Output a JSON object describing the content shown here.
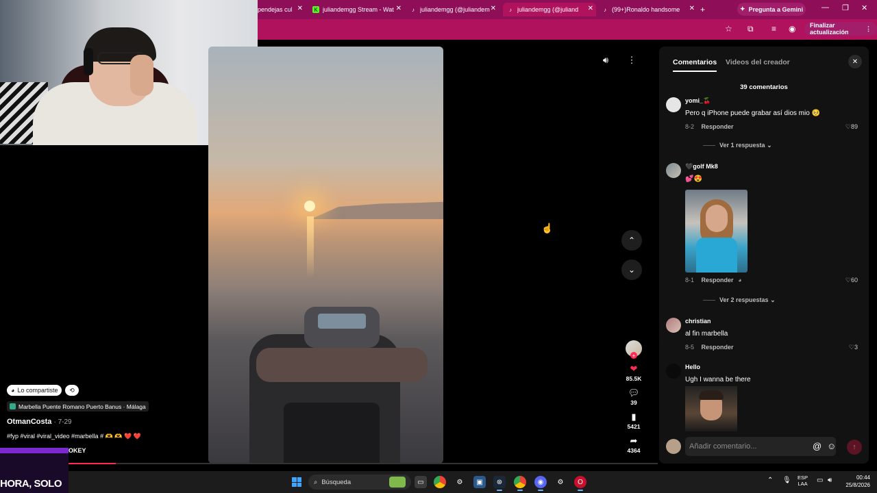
{
  "browser": {
    "tabs": [
      {
        "label": "pendejas cul",
        "active": false
      },
      {
        "label": "juliandemgg Stream - Wat",
        "active": false
      },
      {
        "label": "juliandemgg (@juliandem",
        "active": false
      },
      {
        "label": "juliandemgg (@juliand",
        "active": true
      },
      {
        "label": "(99+)Ronaldo handsome",
        "active": false
      }
    ],
    "new_tab": "+",
    "gemini_label": "Pregunta a Gemini",
    "finalize_update": "Finalizar actualización"
  },
  "video_post": {
    "shared_label": "Lo compartiste",
    "location": "Marbella Puente Romano Puerto Banus · Málaga",
    "author": "OtmanCosta",
    "date": "· 7-29",
    "caption": "#fyp #viral #viral_video #marbella # 🫶 🫶 ❤️ ❤️",
    "music_fragment": "OKEY",
    "progress_fraction": 0.08
  },
  "actions": {
    "likes": "85.5K",
    "comments": "39",
    "saves": "5421",
    "shares": "4364"
  },
  "stream_overlay_text": "HORA, SOLO",
  "comments_panel": {
    "tabs": [
      "Comentarios",
      "Videos del creador"
    ],
    "count_label": "39 comentarios",
    "reply_label": "Responder",
    "items": [
      {
        "user": "yomi_🍒",
        "text": "Pero q iPhone puede grabar así dios mio 🥺",
        "date": "8-2",
        "likes": "89",
        "replies": "Ver 1 respuesta"
      },
      {
        "user": "🖤golf Mk8",
        "text": "💕😍",
        "date": "8-1",
        "likes": "60",
        "replies": "Ver 2 respuestas"
      },
      {
        "user": "christian",
        "text": "al fin marbella",
        "date": "8-5",
        "likes": "3"
      },
      {
        "user": "Hello",
        "text": "Ugh I wanna be there"
      }
    ],
    "input_placeholder": "Añadir comentario..."
  },
  "taskbar": {
    "search_label": "Búsqueda",
    "lang_line1": "ESP",
    "lang_line2": "LAA",
    "time": "00:44",
    "date": "25/8/2026"
  },
  "colors": {
    "browser_tabbar": "#8e0e58",
    "browser_toolbar": "#b0125e",
    "tiktok_red": "#fe2c55",
    "panel_bg": "#121212"
  }
}
